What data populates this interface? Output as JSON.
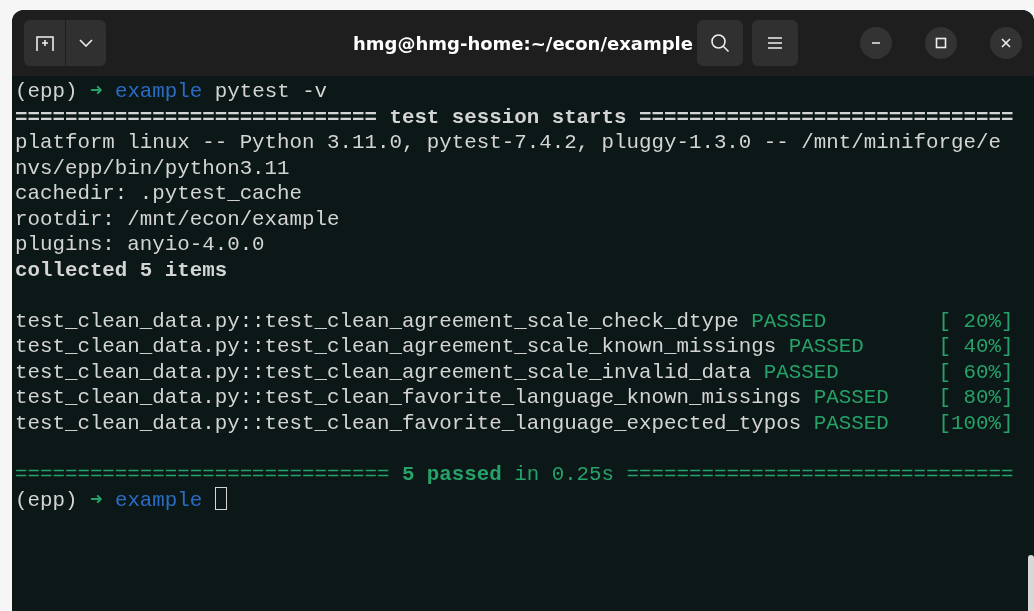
{
  "window": {
    "title": "hmg@hmg-home:~/econ/example"
  },
  "terminal": {
    "lines": [
      {
        "kind": "prompt",
        "env": "(epp)",
        "arrow": "➜",
        "dir": "example",
        "command": "pytest -v"
      },
      {
        "kind": "heading",
        "fill_left": "=============================",
        "label": "test session starts",
        "fill_right": "=============================="
      },
      {
        "kind": "text",
        "bold": false,
        "text": "platform linux -- Python 3.11.0, pytest-7.4.2, pluggy-1.3.0 -- /mnt/miniforge/e"
      },
      {
        "kind": "text",
        "bold": false,
        "text": "nvs/epp/bin/python3.11"
      },
      {
        "kind": "text",
        "bold": false,
        "text": "cachedir: .pytest_cache"
      },
      {
        "kind": "text",
        "bold": false,
        "text": "rootdir: /mnt/econ/example"
      },
      {
        "kind": "text",
        "bold": false,
        "text": "plugins: anyio-4.0.0"
      },
      {
        "kind": "text",
        "bold": true,
        "text": "collected 5 items"
      },
      {
        "kind": "blank"
      },
      {
        "kind": "result",
        "test": "test_clean_data.py::test_clean_agreement_scale_check_dtype",
        "outcome": "PASSED",
        "progress": "[ 20%]"
      },
      {
        "kind": "result",
        "test": "test_clean_data.py::test_clean_agreement_scale_known_missings",
        "outcome": "PASSED",
        "progress": "[ 40%]"
      },
      {
        "kind": "result",
        "test": "test_clean_data.py::test_clean_agreement_scale_invalid_data",
        "outcome": "PASSED",
        "progress": "[ 60%]"
      },
      {
        "kind": "result",
        "test": "test_clean_data.py::test_clean_favorite_language_known_missings",
        "outcome": "PASSED",
        "progress": "[ 80%]"
      },
      {
        "kind": "result",
        "test": "test_clean_data.py::test_clean_favorite_language_expected_typos",
        "outcome": "PASSED",
        "progress": "[100%]"
      },
      {
        "kind": "blank"
      },
      {
        "kind": "summary",
        "fill_left": "==============================",
        "label": "**5 passed** in 0.25s",
        "fill_right": "==============================="
      },
      {
        "kind": "prompt",
        "env": "(epp)",
        "arrow": "➜",
        "dir": "example",
        "cursor": true
      }
    ]
  }
}
